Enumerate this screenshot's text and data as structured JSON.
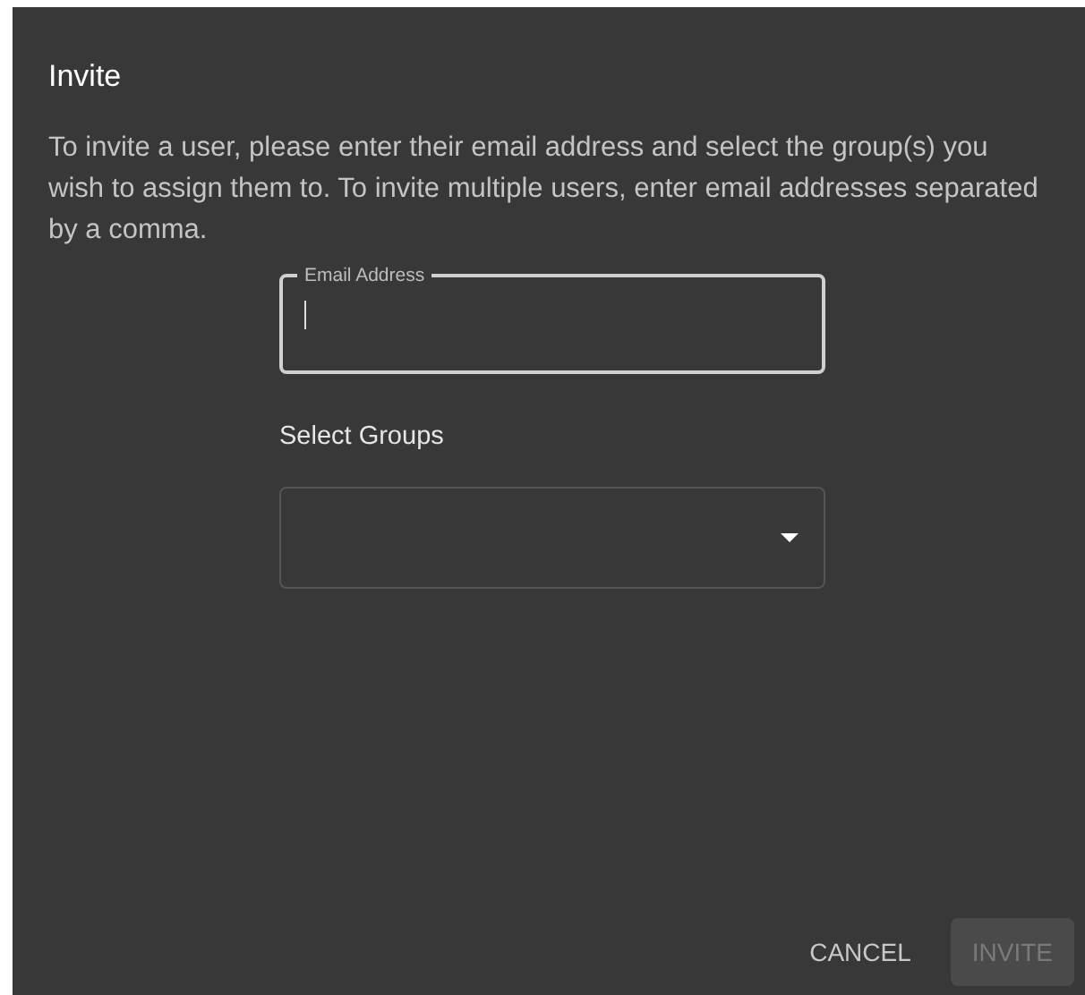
{
  "dialog": {
    "title": "Invite",
    "description": "To invite a user, please enter their email address and select the group(s) you wish to assign them to. To invite multiple users, enter email addresses separated by a comma.",
    "email_field": {
      "label": "Email Address",
      "focused": true
    },
    "groups": {
      "label": "Select Groups"
    },
    "buttons": [
      {
        "label": "CANCEL",
        "kind": "text",
        "disabled": false
      },
      {
        "label": "INVITE",
        "kind": "contained",
        "disabled": true
      }
    ]
  }
}
